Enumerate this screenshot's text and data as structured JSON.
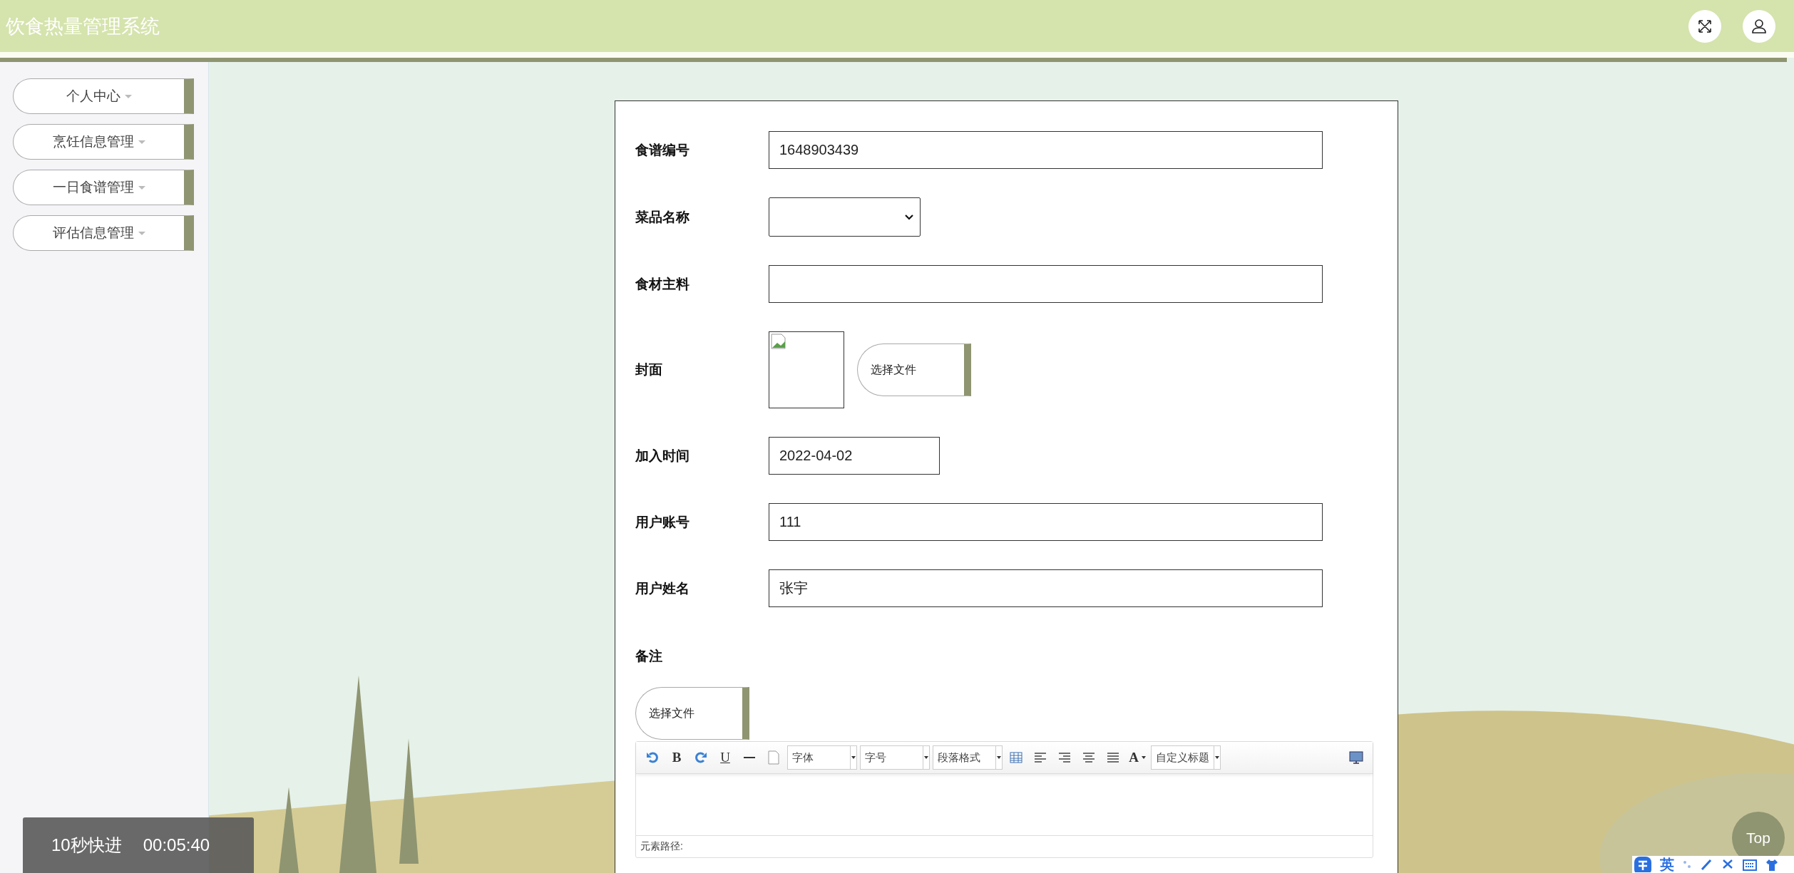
{
  "header": {
    "title": "饮食热量管理系统"
  },
  "sidebar": {
    "items": [
      {
        "label": "个人中心"
      },
      {
        "label": "烹饪信息管理"
      },
      {
        "label": "一日食谱管理"
      },
      {
        "label": "评估信息管理"
      }
    ]
  },
  "form": {
    "fields": [
      {
        "kind": "text",
        "label": "食谱编号",
        "value": "1648903439"
      },
      {
        "kind": "select",
        "label": "菜品名称"
      },
      {
        "kind": "text",
        "label": "食材主料"
      },
      {
        "kind": "image",
        "label": "封面",
        "button": "选择文件"
      },
      {
        "kind": "date",
        "label": "加入时间",
        "value": "2022-04-02"
      },
      {
        "kind": "text",
        "label": "用户账号",
        "value": "111"
      },
      {
        "kind": "text",
        "label": "用户姓名",
        "value": "张宇"
      }
    ],
    "remark": {
      "label": "备注",
      "upload_button": "选择文件",
      "editor": {
        "toolbar": [
          {
            "kind": "undo"
          },
          {
            "kind": "glyph",
            "label": "B"
          },
          {
            "kind": "redo"
          },
          {
            "kind": "underline",
            "label": "U"
          },
          {
            "kind": "hr"
          },
          {
            "kind": "page"
          },
          {
            "kind": "dropdown",
            "label": "字体"
          },
          {
            "kind": "dropdown",
            "label": "字号"
          },
          {
            "kind": "dropdown",
            "label": "段落格式"
          },
          {
            "kind": "table"
          },
          {
            "kind": "align-left"
          },
          {
            "kind": "align-right"
          },
          {
            "kind": "align-center"
          },
          {
            "kind": "justify"
          },
          {
            "kind": "color",
            "label": "A"
          },
          {
            "kind": "dropdown",
            "label": "自定义标题"
          },
          {
            "kind": "preview"
          }
        ],
        "path_label": "元素路径:"
      }
    }
  },
  "video_toast": {
    "action": "10秒快进",
    "time": "00:05:40"
  },
  "top_button": "Top",
  "ime_bar": {
    "mode": "英"
  }
}
